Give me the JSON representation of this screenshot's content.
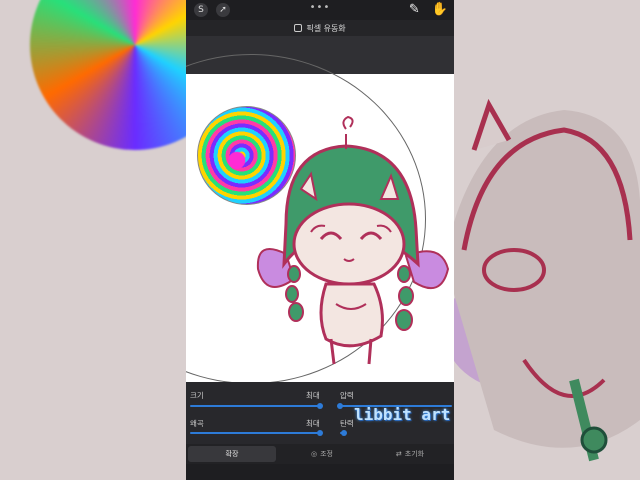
{
  "app": {
    "tool_name": "픽셀 유동화",
    "more_dots": "•••"
  },
  "panel": {
    "size_label": "크기",
    "size_value": "최대",
    "pressure_label": "압력",
    "distortion_label": "왜곡",
    "distortion_value": "최대",
    "momentum_label": "탄력",
    "tabs": [
      {
        "label": "확장",
        "icon": "expand-icon",
        "active": true
      },
      {
        "label": "조정",
        "icon": "adjust-icon",
        "active": false
      },
      {
        "label": "초기화",
        "icon": "reset-icon",
        "active": false
      }
    ]
  },
  "watermark": "libbit art",
  "colors": {
    "accent": "#2d7bd8",
    "hair": "#3f9a6a",
    "outline": "#b0305a",
    "bow": "#c98be0"
  }
}
